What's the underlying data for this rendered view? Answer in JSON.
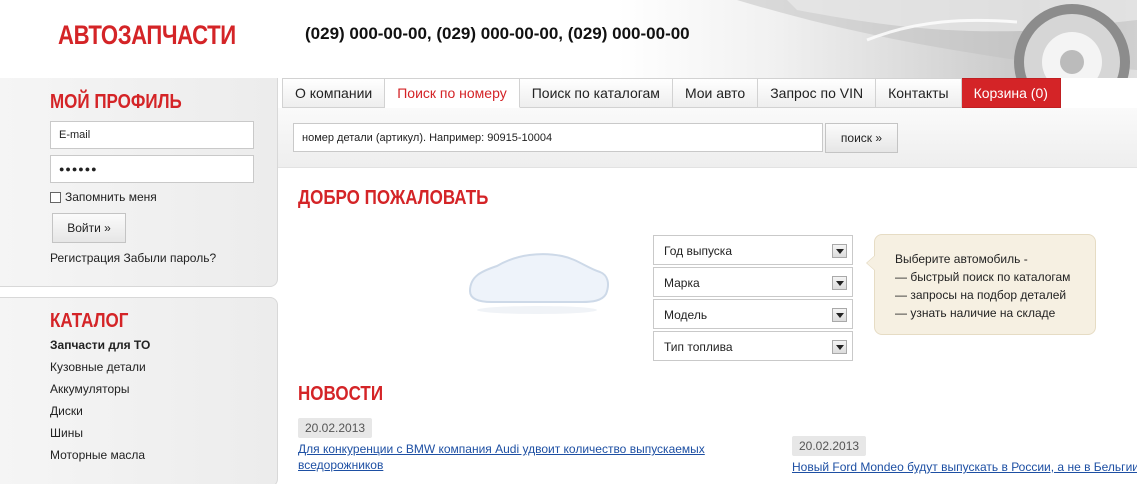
{
  "header": {
    "logo": "АВТОЗАПЧАСТИ",
    "phones": "(029) 000-00-00, (029) 000-00-00, (029) 000-00-00"
  },
  "profile": {
    "title": "МОЙ ПРОФИЛЬ",
    "email_value": "E-mail",
    "password_value": "●●●●●●",
    "remember": "Запомнить меня",
    "login": "Войти »",
    "register": "Регистрация",
    "forgot": "Забыли пароль?"
  },
  "catalog": {
    "title": "КАТАЛОГ",
    "items": [
      "Запчасти для ТО",
      "Кузовные детали",
      "Аккумуляторы",
      "Диски",
      "Шины",
      "Моторные масла"
    ]
  },
  "tabs": [
    "О компании",
    "Поиск по номеру",
    "Поиск по каталогам",
    "Мои авто",
    "Запрос по VIN",
    "Контакты",
    "Корзина (0)"
  ],
  "search": {
    "value": "номер детали (артикул). Например: 90915-10004",
    "button": "поиск »"
  },
  "welcome": {
    "title": "ДОБРО ПОЖАЛОВАТЬ",
    "selects": [
      "Год выпуска",
      "Марка",
      "Модель",
      "Тип топлива"
    ],
    "tip": [
      "Выберите автомобиль -",
      "— быстрый поиск по каталогам",
      "— запросы на подбор деталей",
      "— узнать наличие на складе"
    ]
  },
  "news": {
    "title": "НОВОСТИ",
    "items": [
      {
        "date": "20.02.2013",
        "text": "Для конкуренции с BMW компания Audi удвоит количество выпускаемых вседорожников"
      },
      {
        "date": "20.02.2013",
        "text": "Новый Ford Mondeo будут выпускать в России, а не в Бельгии"
      }
    ]
  },
  "colors": {
    "accent": "#d42427",
    "link": "#1d4fa3"
  }
}
